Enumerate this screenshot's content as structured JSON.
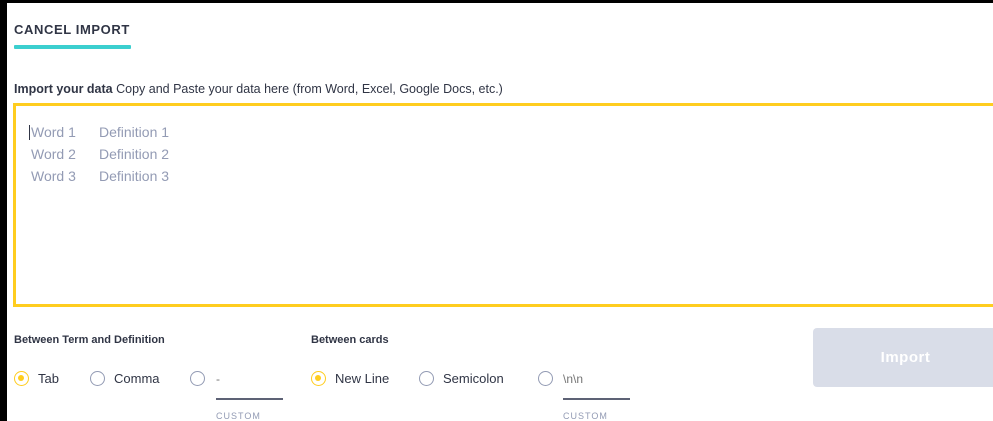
{
  "header": {
    "cancel_label": "CANCEL IMPORT"
  },
  "import_section": {
    "label_bold": "Import your data",
    "label_rest": " Copy and Paste your data here (from Word, Excel, Google Docs, etc.)",
    "placeholder_rows": [
      {
        "term": "Word 1",
        "definition": "Definition 1"
      },
      {
        "term": "Word 2",
        "definition": "Definition 2"
      },
      {
        "term": "Word 3",
        "definition": "Definition 3"
      }
    ]
  },
  "term_separator": {
    "title": "Between Term and Definition",
    "options": [
      {
        "label": "Tab",
        "selected": true
      },
      {
        "label": "Comma",
        "selected": false
      }
    ],
    "custom_placeholder": "-",
    "custom_caption": "CUSTOM"
  },
  "card_separator": {
    "title": "Between cards",
    "options": [
      {
        "label": "New Line",
        "selected": true
      },
      {
        "label": "Semicolon",
        "selected": false
      }
    ],
    "custom_placeholder": "\\n\\n",
    "custom_caption": "CUSTOM"
  },
  "import_button": {
    "label": "Import",
    "disabled": true
  },
  "colors": {
    "accent_yellow": "#ffcd1f",
    "accent_teal": "#3ccfcf",
    "text_dark": "#303545",
    "text_muted": "#939bb4",
    "button_disabled": "#d9dde8"
  }
}
